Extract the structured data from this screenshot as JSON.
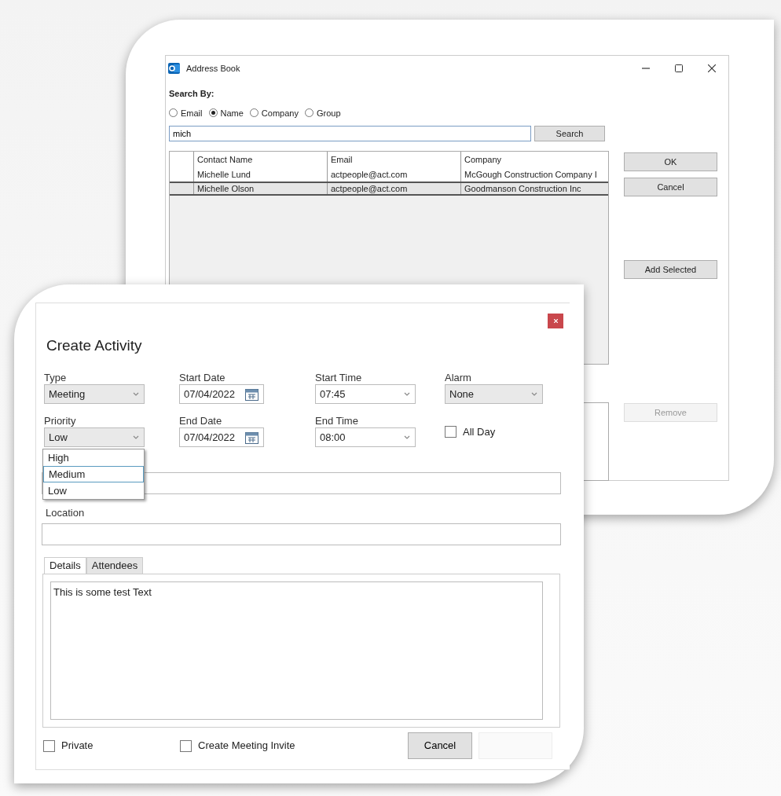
{
  "address_book": {
    "title": "Address Book",
    "search_by_label": "Search By:",
    "search_options": [
      {
        "label": "Email",
        "selected": false
      },
      {
        "label": "Name",
        "selected": true
      },
      {
        "label": "Company",
        "selected": false
      },
      {
        "label": "Group",
        "selected": false
      }
    ],
    "search_value": "mich",
    "search_button": "Search",
    "table": {
      "columns": [
        "Contact Name",
        "Email",
        "Company"
      ],
      "rows": [
        {
          "cells": [
            "Michelle Lund",
            "actpeople@act.com",
            "McGough Construction Company I"
          ],
          "selected": false
        },
        {
          "cells": [
            "Michelle Olson",
            "actpeople@act.com",
            "Goodmanson Construction Inc"
          ],
          "selected": true
        }
      ]
    },
    "buttons": [
      {
        "label": "OK",
        "disabled": false
      },
      {
        "label": "Cancel",
        "disabled": false
      },
      {
        "label": "Add Selected",
        "disabled": false
      },
      {
        "label": "Remove",
        "disabled": true
      }
    ]
  },
  "create_activity": {
    "title": "Create Activity",
    "fields": [
      {
        "label": "Type",
        "value": "Meeting",
        "kind": "select"
      },
      {
        "label": "Start Date",
        "value": "07/04/2022",
        "kind": "date"
      },
      {
        "label": "Start Time",
        "value": "07:45",
        "kind": "time"
      },
      {
        "label": "Alarm",
        "value": "None",
        "kind": "select"
      },
      {
        "label": "Priority",
        "value": "Low",
        "kind": "select"
      },
      {
        "label": "End Date",
        "value": "07/04/2022",
        "kind": "date"
      },
      {
        "label": "End Time",
        "value": "08:00",
        "kind": "time"
      },
      {
        "label": "All Day",
        "checked": false,
        "kind": "checkbox"
      }
    ],
    "priority_options": [
      {
        "label": "High",
        "highlighted": false
      },
      {
        "label": "Medium",
        "highlighted": true
      },
      {
        "label": "Low",
        "highlighted": false
      }
    ],
    "location_label": "Location",
    "tabs": [
      {
        "label": "Details",
        "selected": true
      },
      {
        "label": "Attendees",
        "selected": false
      }
    ],
    "details_text": "This is some test Text",
    "checkboxes": [
      {
        "label": "Private",
        "checked": false
      },
      {
        "label": "Create Meeting Invite",
        "checked": false
      }
    ],
    "cancel_button": "Cancel"
  }
}
